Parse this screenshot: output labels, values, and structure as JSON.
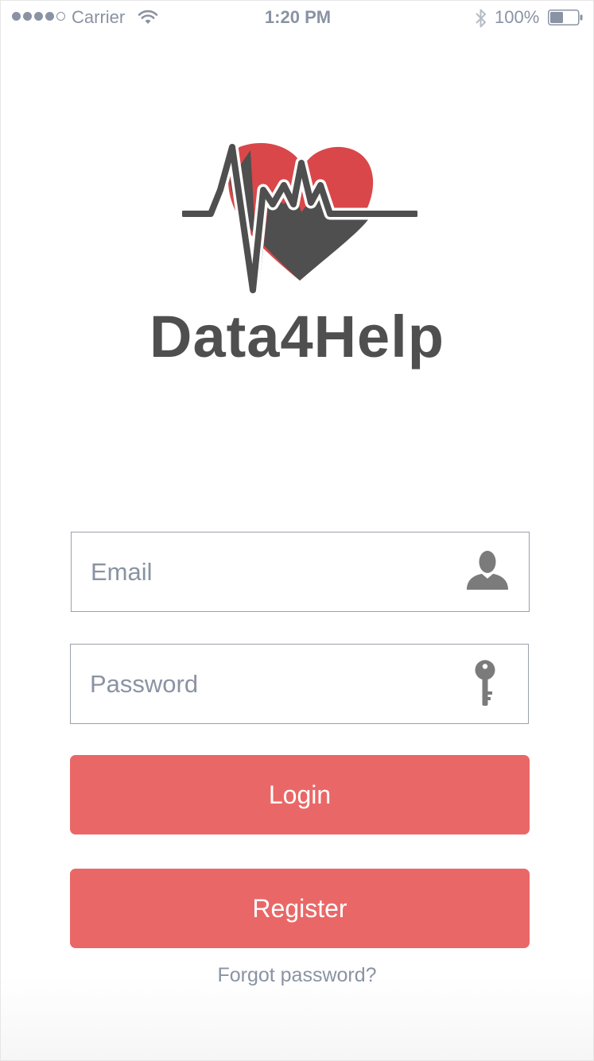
{
  "status_bar": {
    "carrier": "Carrier",
    "time": "1:20 PM",
    "battery": "100%",
    "signal_bars_filled": 4,
    "signal_bars_total": 5
  },
  "brand": {
    "name": "Data4Help",
    "colors": {
      "heart": "#d9474a",
      "dark": "#4f4f4f"
    }
  },
  "login_form": {
    "email_placeholder": "Email",
    "password_placeholder": "Password",
    "email_icon": "user-icon",
    "password_icon": "key-icon",
    "login_label": "Login",
    "register_label": "Register",
    "forgot_label": "Forgot password?"
  },
  "colors": {
    "accent": "#e96867",
    "muted_text": "#8a93a3",
    "border": "#9aa0ac"
  }
}
